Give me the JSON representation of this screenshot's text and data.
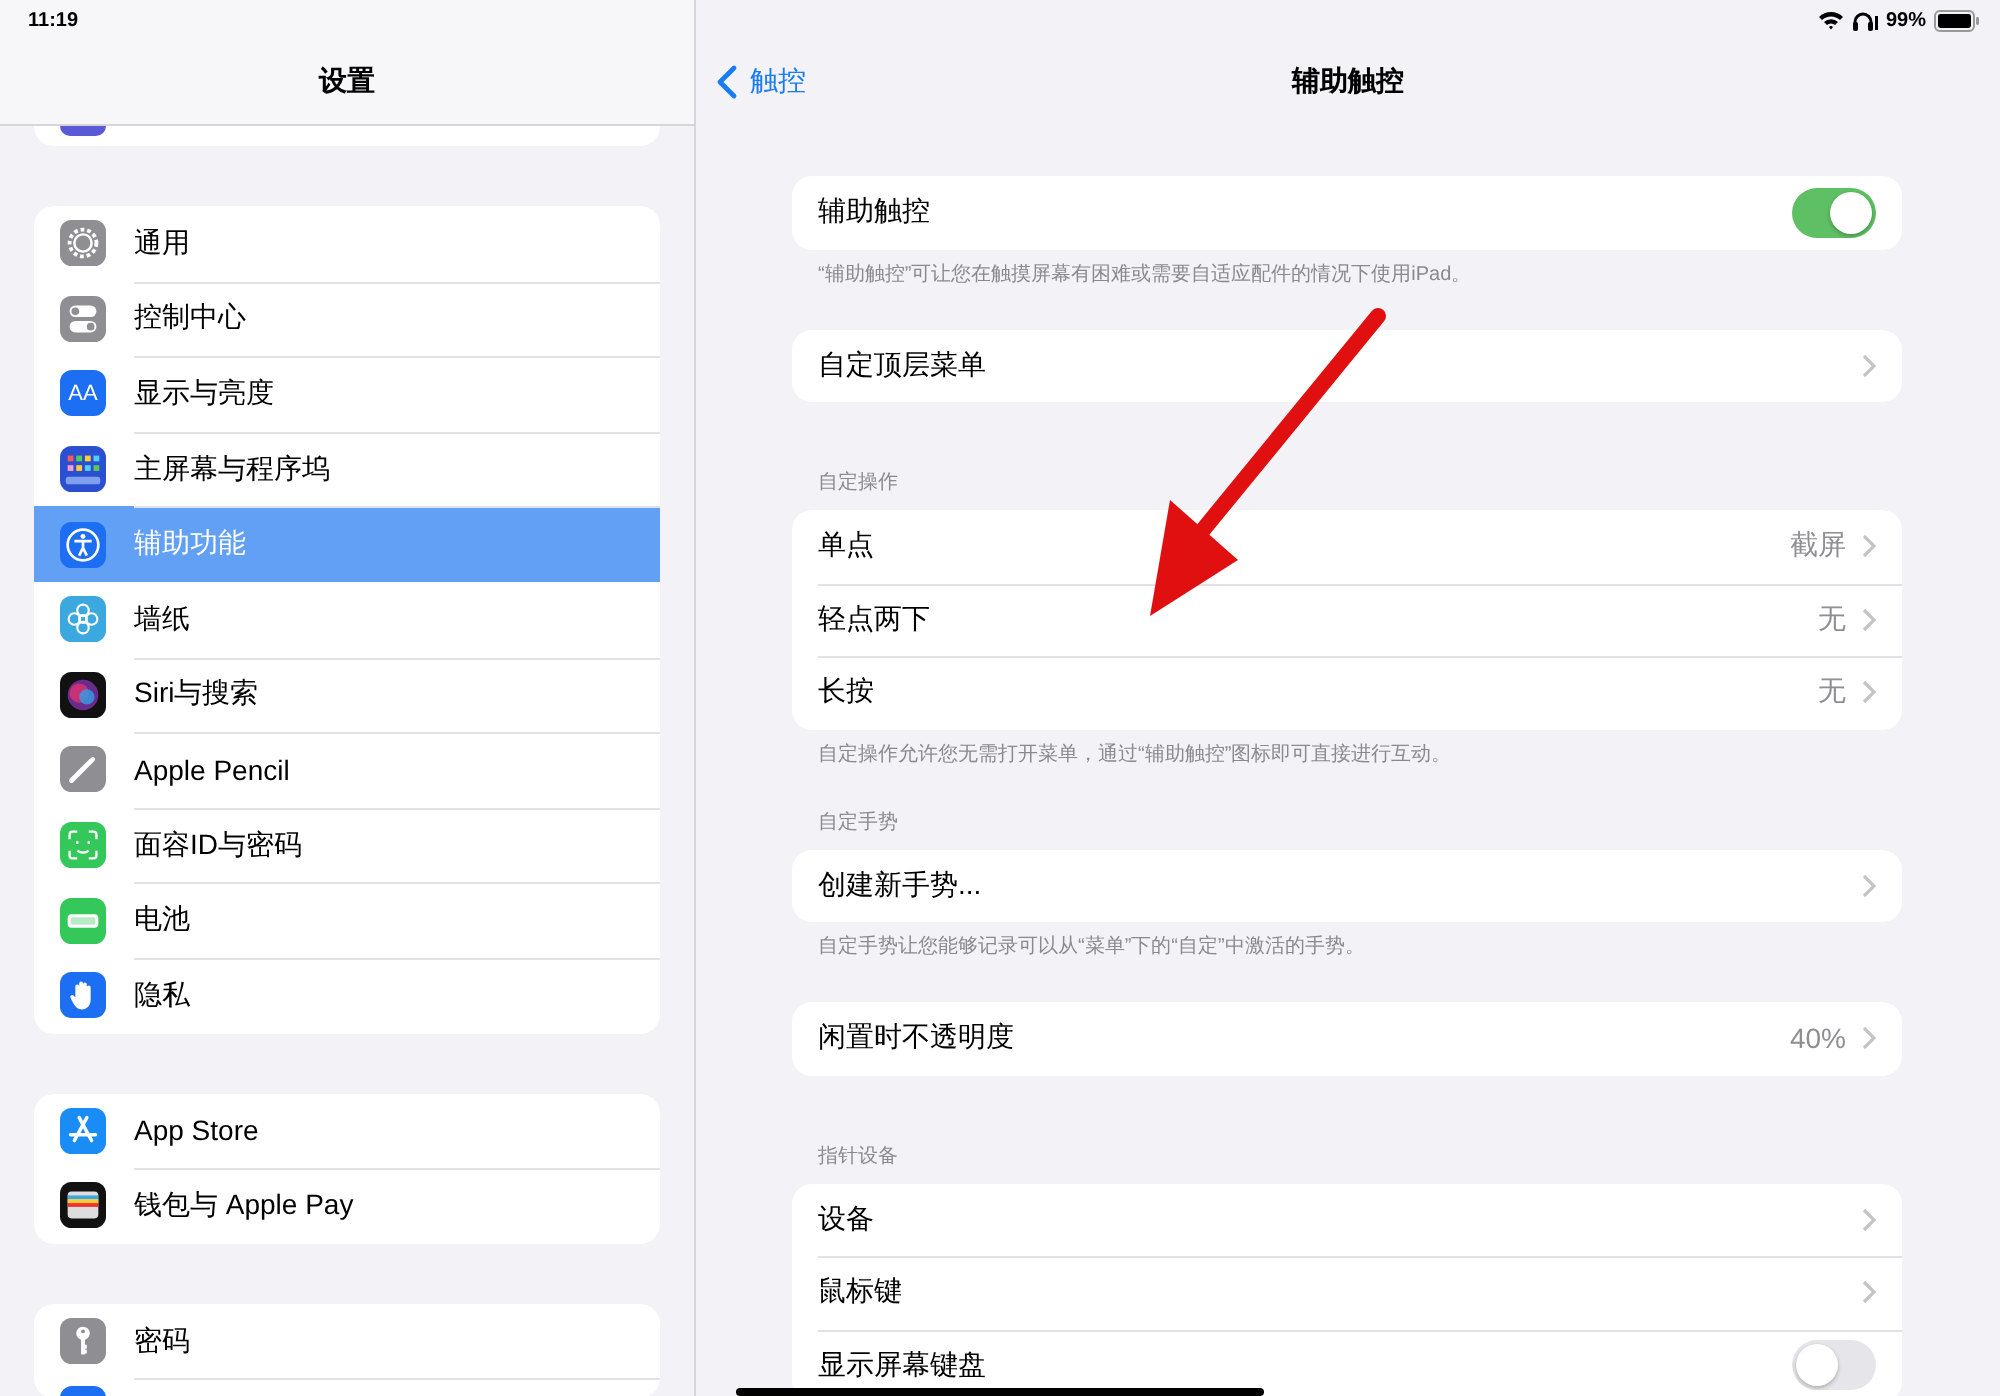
{
  "status_bar": {
    "time": "11:19",
    "battery": "99%"
  },
  "sidebar": {
    "title": "设置",
    "groups": [
      {
        "items": [
          {
            "label": "通用",
            "selected": false
          },
          {
            "label": "控制中心",
            "selected": false
          },
          {
            "label": "显示与亮度",
            "selected": false,
            "icon_text": "AA"
          },
          {
            "label": "主屏幕与程序坞",
            "selected": false
          },
          {
            "label": "辅助功能",
            "selected": true
          },
          {
            "label": "墙纸",
            "selected": false
          },
          {
            "label": "Siri与搜索",
            "selected": false
          },
          {
            "label": "Apple Pencil",
            "selected": false
          },
          {
            "label": "面容ID与密码",
            "selected": false
          },
          {
            "label": "电池",
            "selected": false
          },
          {
            "label": "隐私",
            "selected": false
          }
        ]
      },
      {
        "items": [
          {
            "label": "App Store",
            "selected": false
          },
          {
            "label": "钱包与 Apple Pay",
            "selected": false
          }
        ]
      },
      {
        "items": [
          {
            "label": "密码",
            "selected": false
          }
        ]
      }
    ]
  },
  "detail": {
    "back": "触控",
    "title": "辅助触控",
    "sections": [
      {
        "rows": [
          {
            "kind": "toggle",
            "label": "辅助触控",
            "on": true
          }
        ],
        "footer": "“辅助触控”可让您在触摸屏幕有困难或需要自适应配件的情况下使用iPad。"
      },
      {
        "rows": [
          {
            "kind": "disclosure",
            "label": "自定顶层菜单"
          }
        ]
      },
      {
        "header": "自定操作",
        "rows": [
          {
            "kind": "disclosure",
            "label": "单点",
            "value": "截屏"
          },
          {
            "kind": "disclosure",
            "label": "轻点两下",
            "value": "无"
          },
          {
            "kind": "disclosure",
            "label": "长按",
            "value": "无"
          }
        ],
        "footer": "自定操作允许您无需打开菜单，通过“辅助触控”图标即可直接进行互动。"
      },
      {
        "header": "自定手势",
        "rows": [
          {
            "kind": "disclosure",
            "label": "创建新手势..."
          }
        ],
        "footer": "自定手势让您能够记录可以从“菜单”下的“自定”中激活的手势。"
      },
      {
        "rows": [
          {
            "kind": "disclosure",
            "label": "闲置时不透明度",
            "value": "40%"
          }
        ]
      },
      {
        "header": "指针设备",
        "rows": [
          {
            "kind": "disclosure",
            "label": "设备"
          },
          {
            "kind": "disclosure",
            "label": "鼠标键"
          },
          {
            "kind": "toggle",
            "label": "显示屏幕键盘",
            "on": false
          }
        ]
      }
    ]
  }
}
